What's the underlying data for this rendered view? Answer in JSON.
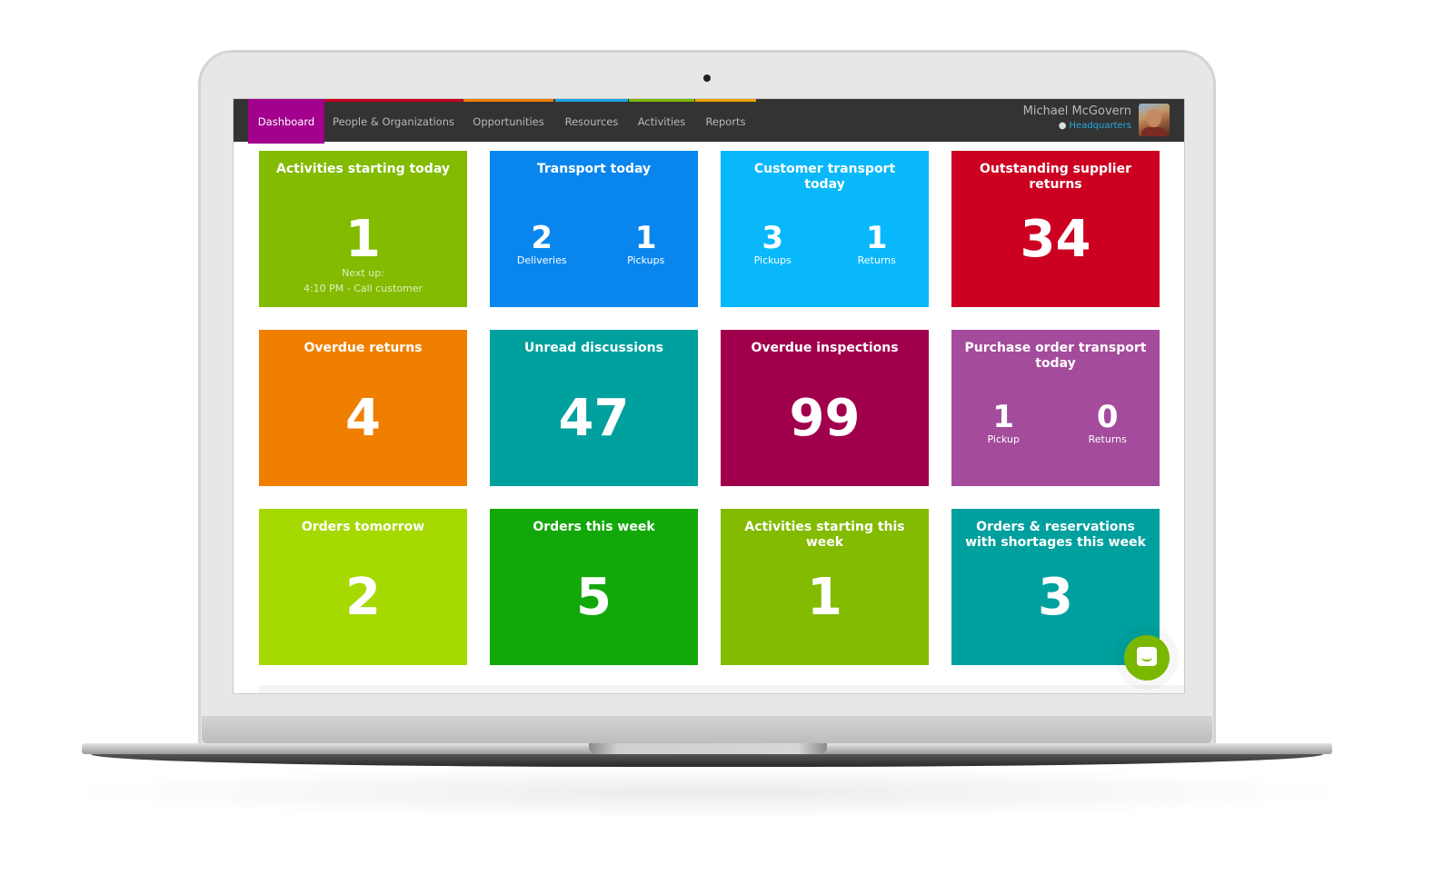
{
  "nav": {
    "items": [
      {
        "label": "Dashboard",
        "active": true,
        "stripe": "#a2008d"
      },
      {
        "label": "People & Organizations",
        "active": false,
        "stripe": "#c8001e"
      },
      {
        "label": "Opportunities",
        "active": false,
        "stripe": "#f07d00"
      },
      {
        "label": "Resources",
        "active": false,
        "stripe": "#1aa3e0"
      },
      {
        "label": "Activities",
        "active": false,
        "stripe": "#7ab800"
      },
      {
        "label": "Reports",
        "active": false,
        "stripe": "#f0a000"
      }
    ]
  },
  "user": {
    "name": "Michael McGovern",
    "location": "Headquarters",
    "location_icon": "map-pin-icon",
    "avatar_icon": "user-avatar"
  },
  "tiles": [
    {
      "title": "Activities starting today",
      "value": "1",
      "sub1": "Next up:",
      "sub2": "4:10 PM - Call customer",
      "color": "#82bb00"
    },
    {
      "title": "Transport today",
      "pairs": [
        {
          "num": "2",
          "label": "Deliveries"
        },
        {
          "num": "1",
          "label": "Pickups"
        }
      ],
      "color": "#0986ee"
    },
    {
      "title": "Customer transport today",
      "pairs": [
        {
          "num": "3",
          "label": "Pickups"
        },
        {
          "num": "1",
          "label": "Returns"
        }
      ],
      "color": "#08b8fb"
    },
    {
      "title": "Outstanding supplier returns",
      "value": "34",
      "color": "#cc0021"
    },
    {
      "title": "Overdue returns",
      "value": "4",
      "color": "#f07f00"
    },
    {
      "title": "Unread discussions",
      "value": "47",
      "color": "#00a09e"
    },
    {
      "title": "Overdue inspections",
      "value": "99",
      "color": "#a0004b"
    },
    {
      "title": "Purchase order transport today",
      "pairs": [
        {
          "num": "1",
          "label": "Pickup"
        },
        {
          "num": "0",
          "label": "Returns"
        }
      ],
      "color": "#a54b9b"
    },
    {
      "title": "Orders tomorrow",
      "value": "2",
      "color": "#a5d900"
    },
    {
      "title": "Orders this week",
      "value": "5",
      "color": "#13a80a"
    },
    {
      "title": "Activities starting this week",
      "value": "1",
      "color": "#82bb00"
    },
    {
      "title": "Orders & reservations with shortages this week",
      "value": "3",
      "color": "#00a09e"
    }
  ],
  "chat": {
    "icon": "chat-icon",
    "color": "#7ab800"
  }
}
